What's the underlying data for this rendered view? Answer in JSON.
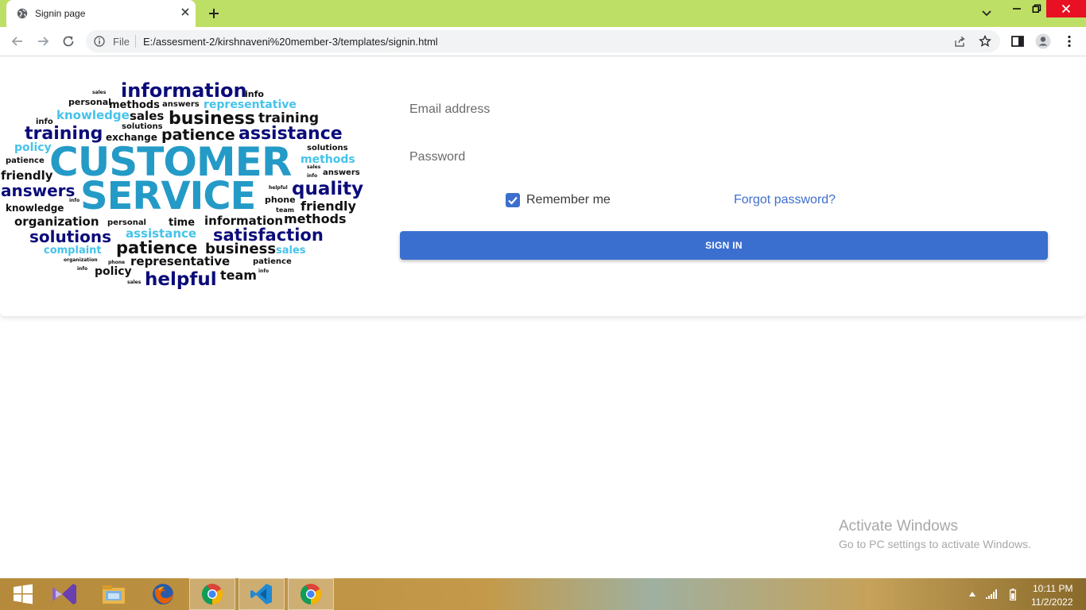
{
  "browser": {
    "tab_title": "Signin page",
    "scheme_label": "File",
    "url": "E:/assesment-2/kirshnaveni%20member-3/templates/signin.html",
    "icons": [
      "globe-icon",
      "close-icon",
      "plus-icon",
      "chevron-down-icon",
      "minimize-icon",
      "maximize-icon",
      "close-icon",
      "back-arrow-icon",
      "forward-arrow-icon",
      "reload-icon",
      "info-icon",
      "share-icon",
      "star-icon",
      "side-panel-icon",
      "profile-icon",
      "kebab-menu-icon"
    ]
  },
  "wordcloud": {
    "image_words": {
      "w1": "information",
      "w2": "info",
      "w3": "sales",
      "w4": "personal",
      "w5": "methods",
      "w6": "answers",
      "w7": "representative",
      "w8": "knowledge",
      "w9": "sales",
      "w10": "business",
      "w11": "info",
      "w12": "solutions",
      "w13": "training",
      "w14": "training",
      "w15": "exchange",
      "w16": "patience",
      "w17": "assistance",
      "w18": "policy",
      "w19": "solutions",
      "w20": "CUSTOMER",
      "w21": "methods",
      "w22": "patience",
      "w23": "sales",
      "w24": "friendly",
      "w25": "answers",
      "w26": "info",
      "w27": "answers",
      "w28": "helpful",
      "w29": "SERVICE",
      "w30": "quality",
      "w31": "info",
      "w32": "phone",
      "w33": "knowledge",
      "w34": "team",
      "w35": "friendly",
      "w36": "organization",
      "w37": "personal",
      "w38": "time",
      "w39": "information",
      "w40": "methods",
      "w41": "solutions",
      "w42": "assistance",
      "w43": "satisfaction",
      "w44": "complaint",
      "w45": "patience",
      "w46": "business",
      "w47": "sales",
      "w48": "organization",
      "w49": "phone",
      "w50": "representative",
      "w51": "patience",
      "w52": "info",
      "w53": "policy",
      "w54": "info",
      "w55": "team",
      "w56": "sales",
      "w57": "helpful"
    }
  },
  "form": {
    "email_label": "Email address",
    "password_label": "Password",
    "remember_label": "Remember me",
    "remember_checked": true,
    "forgot_label": "Forgot password?",
    "signin_label": "SIGN IN",
    "accent_color": "#3b6fcf"
  },
  "watermark": {
    "title": "Activate Windows",
    "subtitle": "Go to PC settings to activate Windows."
  },
  "taskbar": {
    "apps": [
      "windows-start-icon",
      "visual-studio-icon",
      "file-explorer-icon",
      "firefox-icon",
      "chrome-icon",
      "vscode-icon",
      "chrome-icon"
    ],
    "time": "10:11 PM",
    "date": "11/2/2022"
  }
}
